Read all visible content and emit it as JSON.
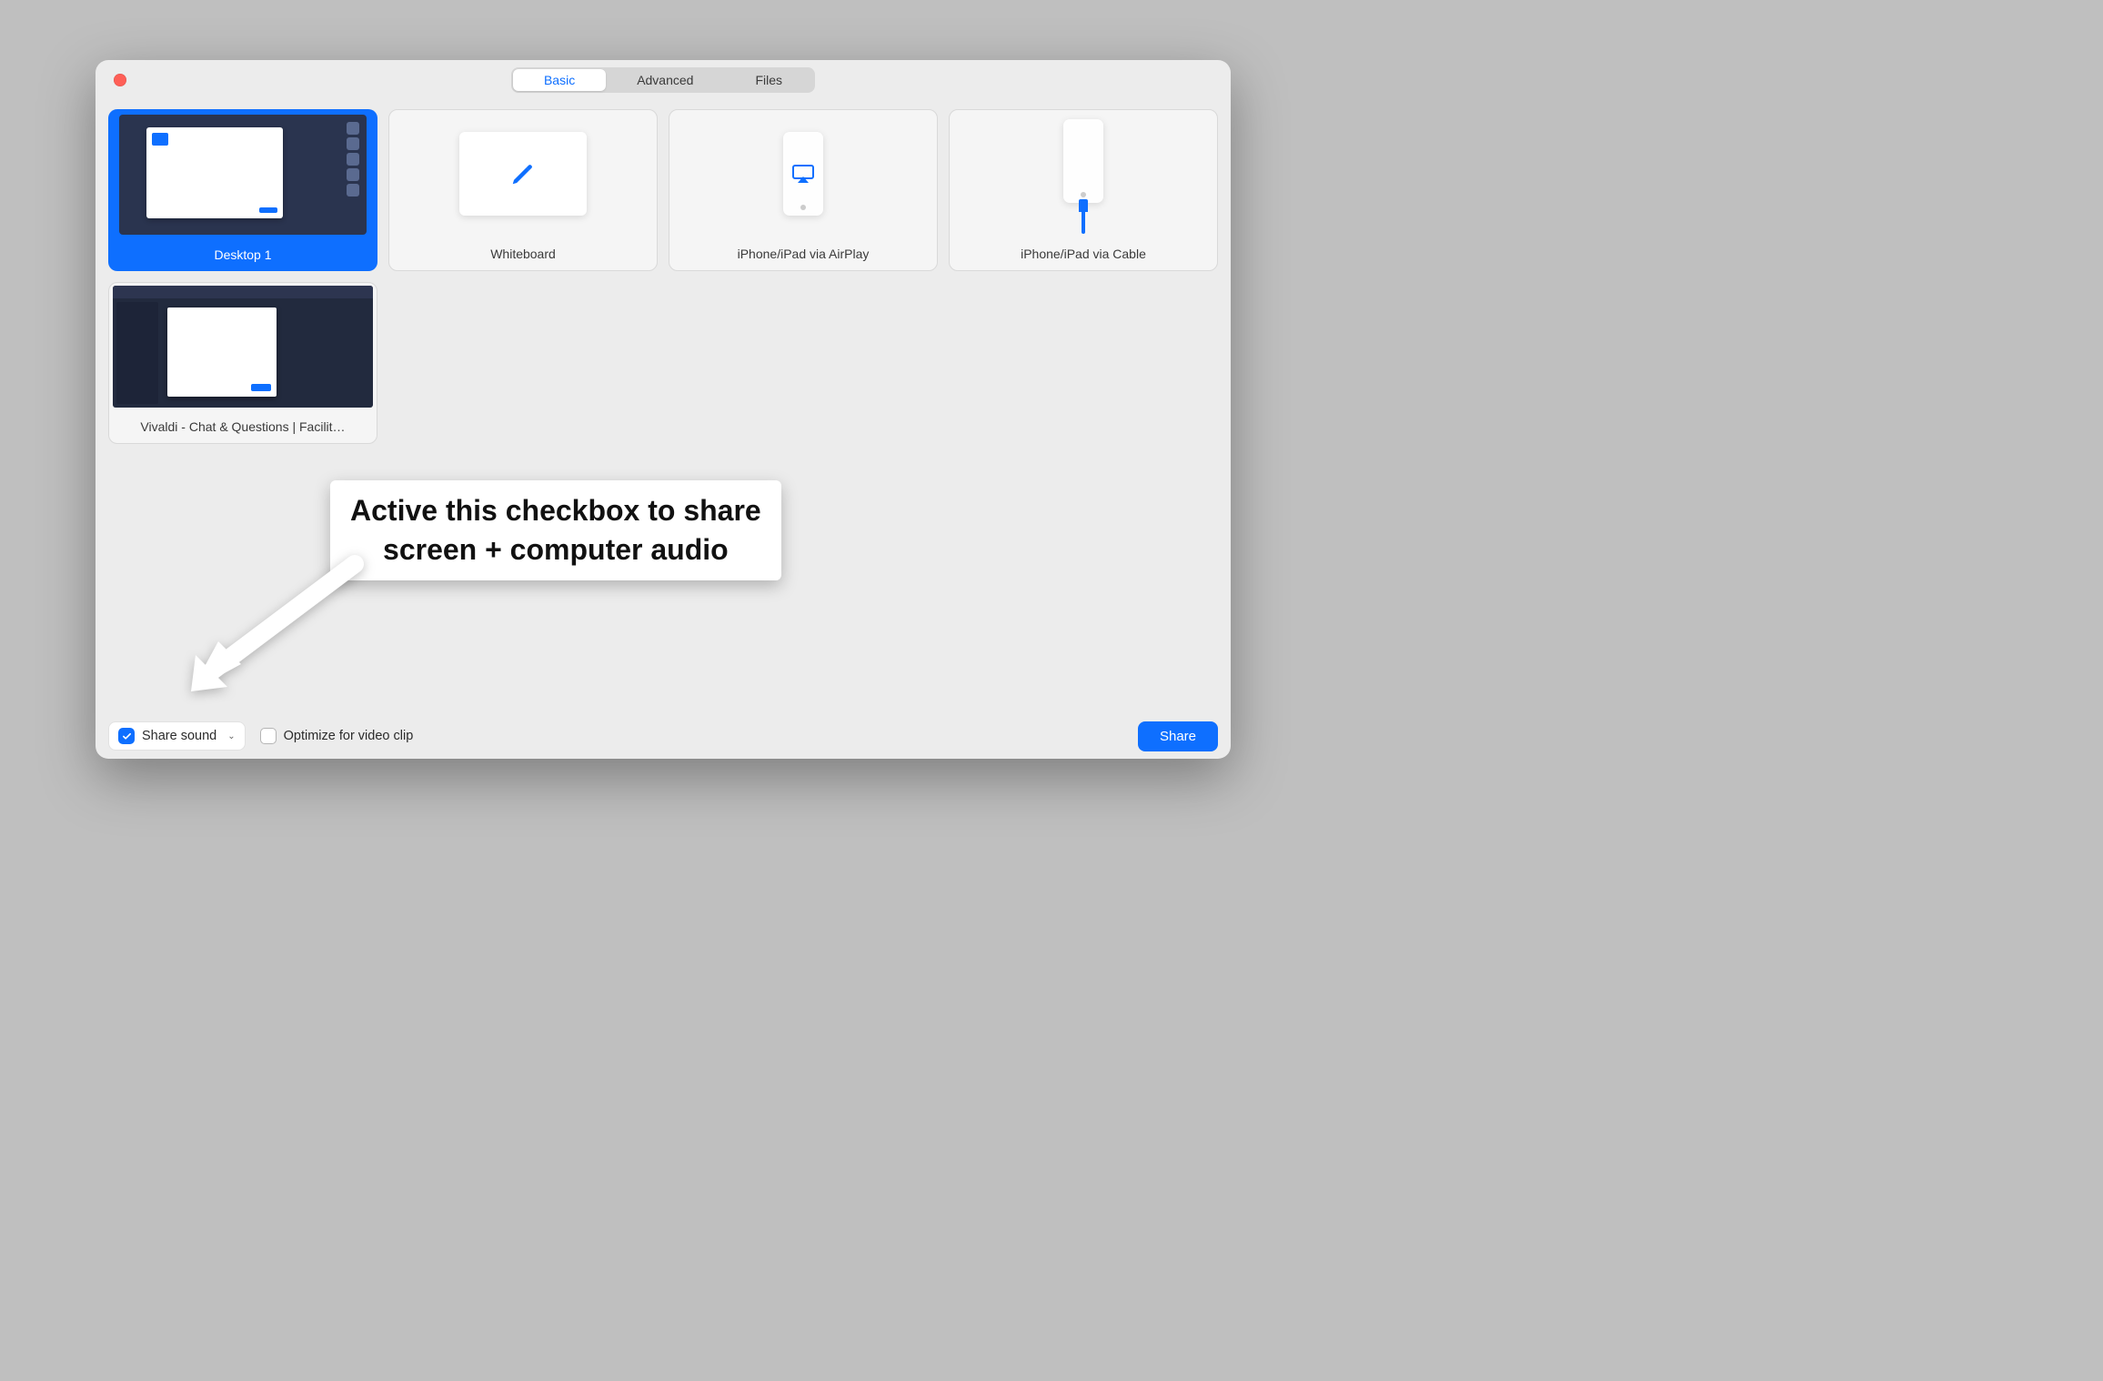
{
  "tabs": {
    "items": [
      {
        "label": "Basic",
        "active": true
      },
      {
        "label": "Advanced",
        "active": false
      },
      {
        "label": "Files",
        "active": false
      }
    ]
  },
  "share_options": [
    {
      "id": "desktop1",
      "label": "Desktop 1",
      "selected": true,
      "kind": "desktop"
    },
    {
      "id": "whiteboard",
      "label": "Whiteboard",
      "selected": false,
      "kind": "whiteboard"
    },
    {
      "id": "airplay",
      "label": "iPhone/iPad via AirPlay",
      "selected": false,
      "kind": "phone-airplay"
    },
    {
      "id": "cable",
      "label": "iPhone/iPad via Cable",
      "selected": false,
      "kind": "phone-cable"
    },
    {
      "id": "vivaldi",
      "label": "Vivaldi - Chat & Questions | Facilit…",
      "selected": false,
      "kind": "app-window"
    }
  ],
  "footer": {
    "share_sound": {
      "label": "Share sound",
      "checked": true
    },
    "optimize": {
      "label": "Optimize for video clip",
      "checked": false
    },
    "share_button": "Share"
  },
  "annotation": {
    "line1": "Active this checkbox to share",
    "line2": "screen + computer audio"
  },
  "icons": {
    "pencil": "pencil-icon",
    "airplay": "airplay-icon"
  },
  "colors": {
    "accent": "#0e6fff",
    "window_bg": "#ececec",
    "page_bg": "#bfbfbf",
    "traffic_close": "#ff5f57"
  }
}
